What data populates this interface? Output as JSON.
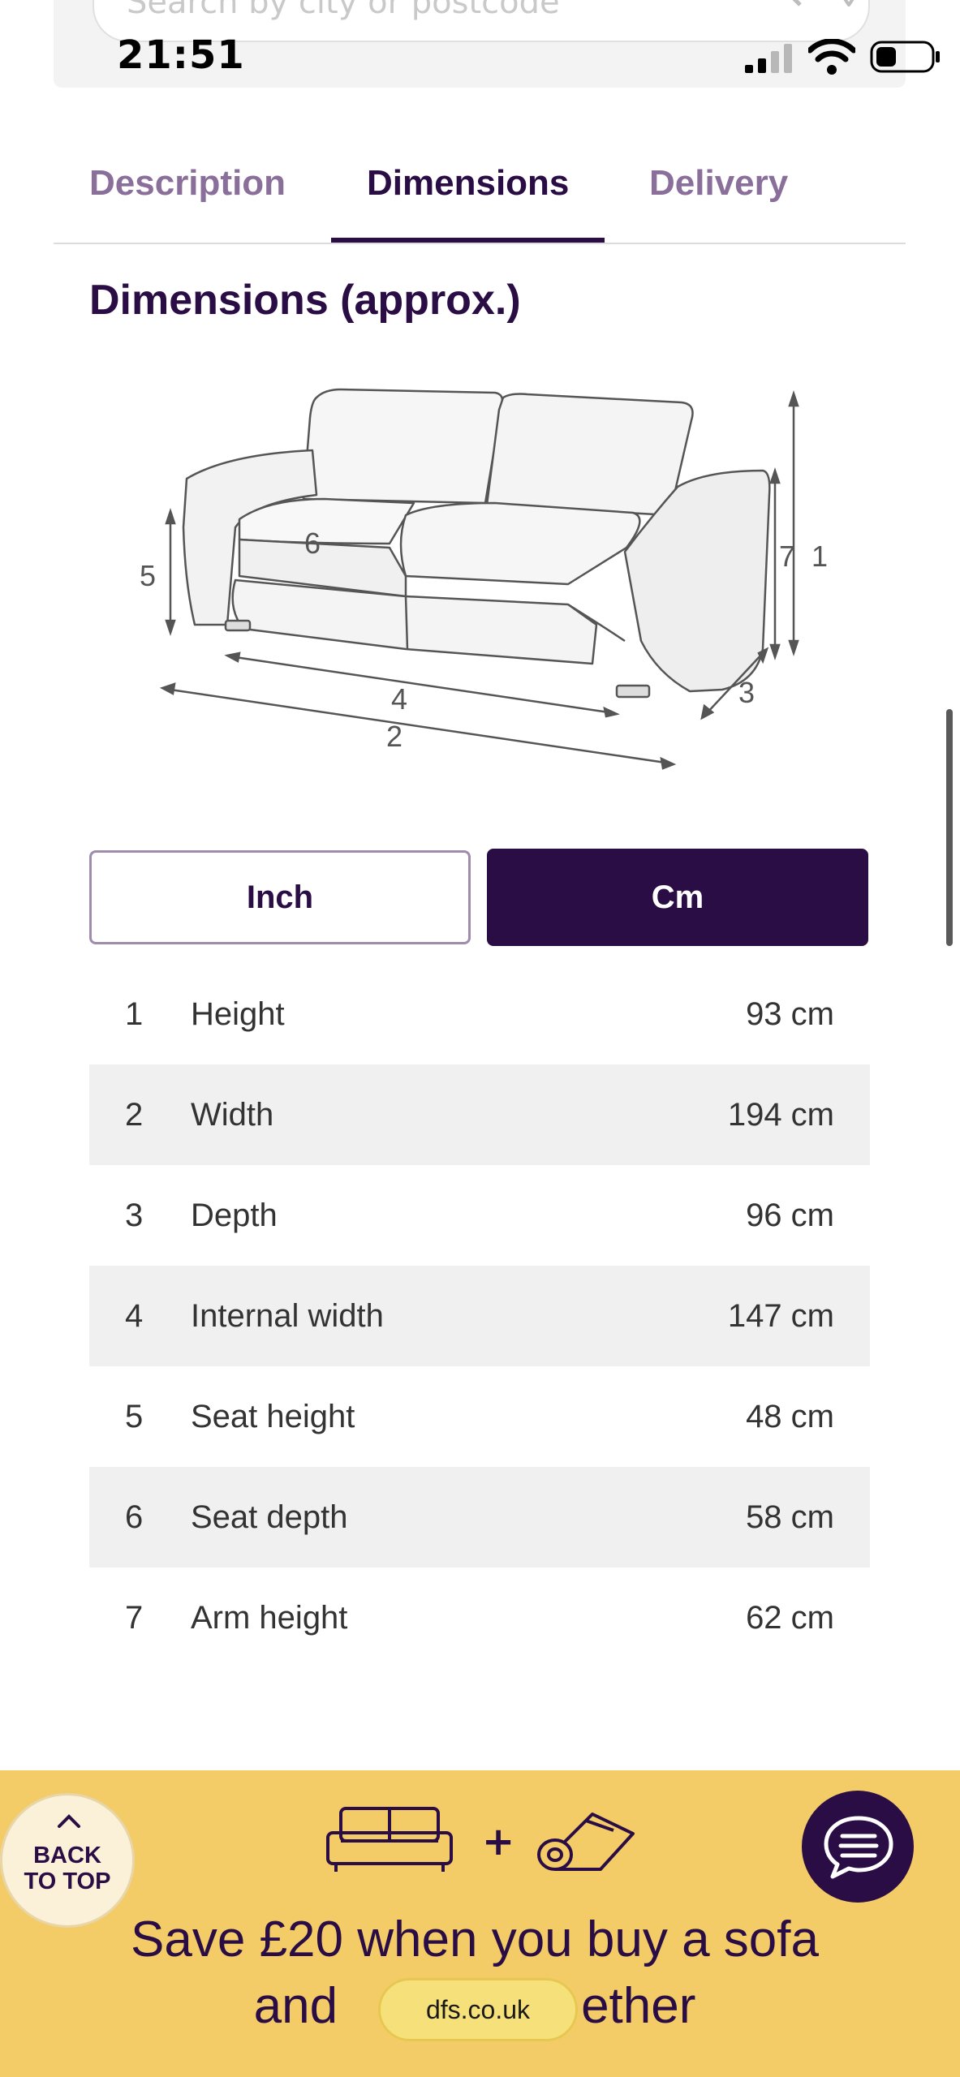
{
  "status_bar": {
    "time": "21:51"
  },
  "search": {
    "placeholder": "Search by city or postcode"
  },
  "tabs": [
    {
      "label": "Description",
      "active": false
    },
    {
      "label": "Dimensions",
      "active": true
    },
    {
      "label": "Delivery",
      "active": false
    }
  ],
  "section_title": "Dimensions (approx.)",
  "diagram_labels": [
    "1",
    "2",
    "3",
    "4",
    "5",
    "6",
    "7"
  ],
  "units": {
    "inch": "Inch",
    "cm": "Cm",
    "selected": "Cm"
  },
  "dimensions": [
    {
      "num": "1",
      "label": "Height",
      "value": "93 cm"
    },
    {
      "num": "2",
      "label": "Width",
      "value": "194 cm"
    },
    {
      "num": "3",
      "label": "Depth",
      "value": "96 cm"
    },
    {
      "num": "4",
      "label": "Internal width",
      "value": "147 cm"
    },
    {
      "num": "5",
      "label": "Seat height",
      "value": "48 cm"
    },
    {
      "num": "6",
      "label": "Seat depth",
      "value": "58 cm"
    },
    {
      "num": "7",
      "label": "Arm height",
      "value": "62 cm"
    }
  ],
  "back_to_top": {
    "label": "BACK\nTO TOP"
  },
  "promo": {
    "plus": "+",
    "line1": "Save £20 when you buy a sofa",
    "line2_start": "and",
    "line2_end": "ether"
  },
  "browser": {
    "url": "dfs.co.uk"
  },
  "colors": {
    "brand": "#2a0d45",
    "promo_bg": "#f4cc67",
    "row_alt": "#f0f0f1"
  }
}
